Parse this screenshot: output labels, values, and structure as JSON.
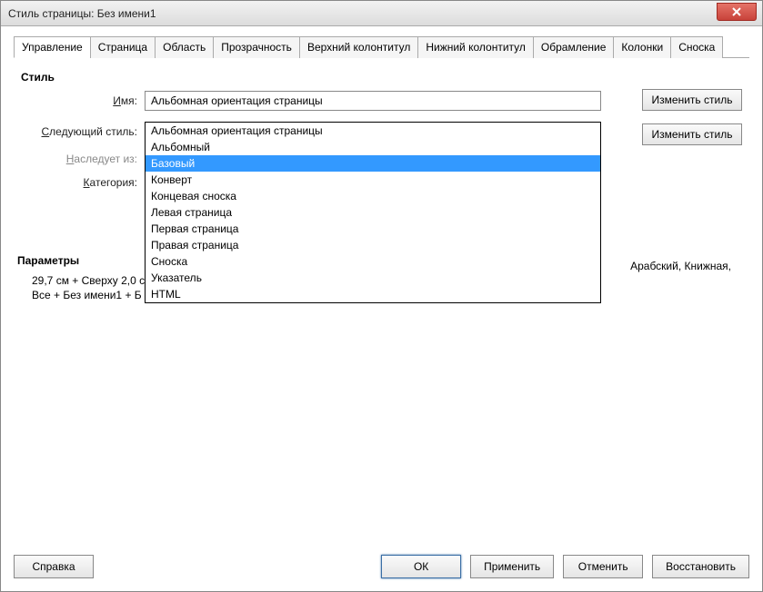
{
  "window": {
    "title": "Стиль страницы: Без имени1"
  },
  "tabs": [
    "Управление",
    "Страница",
    "Область",
    "Прозрачность",
    "Верхний колонтитул",
    "Нижний колонтитул",
    "Обрамление",
    "Колонки",
    "Сноска"
  ],
  "activeTab": 0,
  "section_style": "Стиль",
  "labels": {
    "name": "Имя:",
    "name_u": "И",
    "next": "Следующий стиль:",
    "next_u": "С",
    "inherit": "Наследует из:",
    "inherit_u": "Н",
    "category": "Категория:",
    "category_u": "К"
  },
  "fields": {
    "name_value": "Альбомная ориентация страницы",
    "next_value": "Альбомная ориентация страницы"
  },
  "sidebtn1": "Изменить стиль",
  "sidebtn2": "Изменить стиль",
  "dropdown": {
    "options": [
      "Альбомная ориентация страницы",
      "Альбомный",
      "Базовый",
      "Конверт",
      "Концевая сноска",
      "Левая страница",
      "Первая страница",
      "Правая страница",
      "Сноска",
      "Указатель",
      "HTML"
    ],
    "highlight": 2
  },
  "section_params": "Параметры",
  "params_line1": "29,7 см + Сверху 2,0 с",
  "params_line2": "Все + Без имени1 + Б",
  "params_right": "Арабский, Книжная,",
  "buttons": {
    "help": "Справка",
    "ok": "ОК",
    "apply": "Применить",
    "cancel": "Отменить",
    "restore": "Восстановить"
  }
}
